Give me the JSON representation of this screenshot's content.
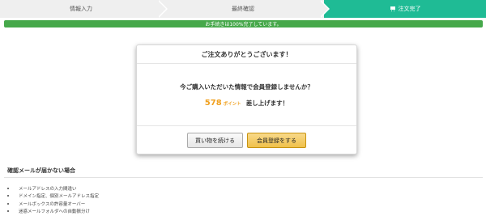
{
  "steps": {
    "step1": "情報入力",
    "step2": "最終確認",
    "step3": "注文完了",
    "active_icon": "cart-icon"
  },
  "progress": {
    "text": "お手続きは100%完了しています。",
    "percent": 100,
    "color": "#46a84a"
  },
  "modal": {
    "title": "ご注文ありがとうございます！",
    "question": "今ご購入いただいた情報で会員登録しませんか？",
    "points_value": "578",
    "points_unit": "ポイント",
    "points_suffix": "差し上げます！",
    "continue_button": "買い物を続ける",
    "register_button": "会員登録をする"
  },
  "help": {
    "title": "確認メールが届かない場合",
    "items": [
      "メールアドレスの入力間違い",
      "ドメイン指定、個別メールアドレス指定",
      "メールボックスの許容量オーバー",
      "迷惑メールフォルダへの自動振分け"
    ]
  },
  "colors": {
    "active_step": "#1fbb95",
    "accent_points": "#f0a01e",
    "register_button": "#f0c14b"
  }
}
